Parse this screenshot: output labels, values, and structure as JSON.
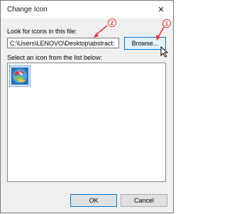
{
  "window": {
    "title": "Change Icon"
  },
  "form": {
    "look_label": "Look for icons in this file:",
    "path_value": "C:\\Users\\LENOVO\\Desktop\\abstract:",
    "browse_label": "Browse...",
    "select_label": "Select an icon from the list below:"
  },
  "buttons": {
    "ok_label": "OK",
    "cancel_label": "Cancel"
  },
  "annotations": {
    "marker_1": "1",
    "marker_2": "2",
    "marker_color": "#e53935"
  },
  "icons": {
    "close": "close-icon",
    "cursor": "mouse-pointer-icon",
    "list_item": "abstract-image-icon"
  }
}
